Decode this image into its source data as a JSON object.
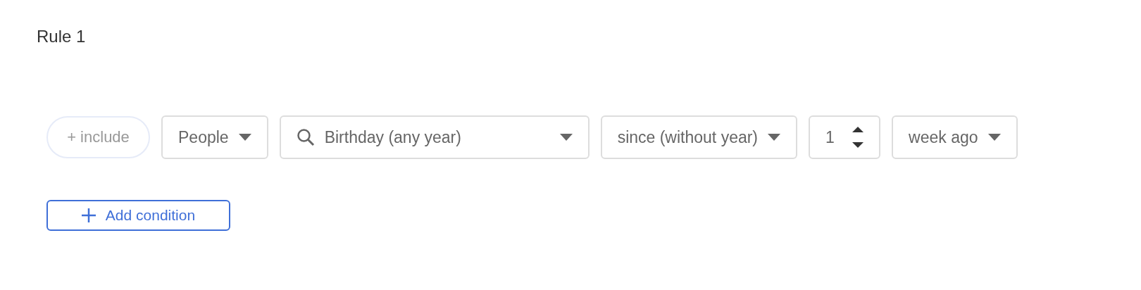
{
  "rule": {
    "title": "Rule 1"
  },
  "conditions": [
    {
      "kind": "pill",
      "label": "+ include"
    },
    {
      "kind": "select",
      "value": "People"
    },
    {
      "kind": "search",
      "value": "Birthday (any year)"
    },
    {
      "kind": "select",
      "value": "since (without year)"
    },
    {
      "kind": "number",
      "value": "1"
    },
    {
      "kind": "select",
      "value": "week ago"
    }
  ],
  "add_button": {
    "label": "Add condition"
  }
}
